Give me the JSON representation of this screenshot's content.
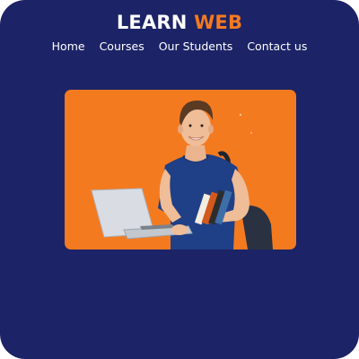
{
  "header": {
    "brand_main": "LEARN",
    "brand_accent": "WEB"
  },
  "nav": {
    "items": [
      {
        "label": "Home"
      },
      {
        "label": "Courses"
      },
      {
        "label": "Our Students"
      },
      {
        "label": "Contact us"
      }
    ]
  },
  "hero": {
    "background": "#f47a20"
  },
  "colors": {
    "page_background": "#1c2366",
    "accent": "#f47a20",
    "text": "#ffffff"
  }
}
